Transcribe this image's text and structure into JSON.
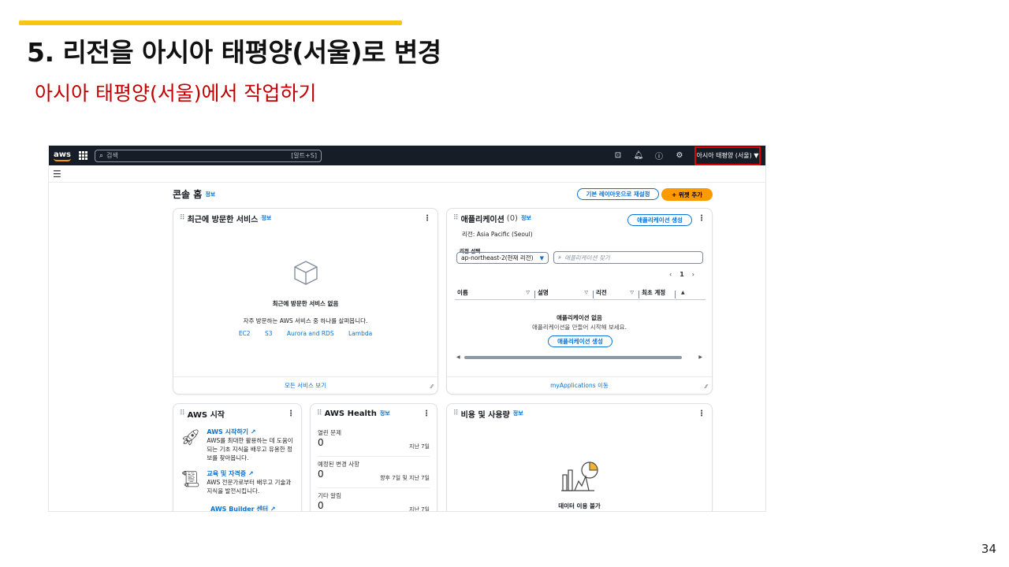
{
  "slide": {
    "title": "5. 리전을 아시아 태평양(서울)로 변경",
    "subtitle": "아시아 태평양(서울)에서 작업하기",
    "page_number": "34",
    "accent_color": "#f5c518",
    "subtitle_color": "#c00000"
  },
  "topnav": {
    "logo": "aws",
    "search_placeholder": "검색",
    "search_shortcut": "[알트+S]",
    "region_label": "아시아 태평양 (서울) ▼"
  },
  "console": {
    "title": "콘솔 홈",
    "info": "정보",
    "reset_button": "기본 레이아웃으로 재설정",
    "add_widget_button": "+ 위젯 추가"
  },
  "recent": {
    "title": "최근에 방문한 서비스",
    "info": "정보",
    "empty_title": "최근에 방문한 서비스 없음",
    "empty_desc": "자주 방문하는 AWS 서비스 중 하나를 살펴봅니다.",
    "links": [
      "EC2",
      "S3",
      "Aurora and RDS",
      "Lambda"
    ],
    "footer": "모든 서비스 보기"
  },
  "apps": {
    "title": "애플리케이션",
    "count": "(0)",
    "info": "정보",
    "create_button": "애플리케이션 생성",
    "region_text": "리전: Asia Pacific (Seoul)",
    "region_select_label": "리전 선택",
    "region_select_value": "ap-northeast-2(현재 리전)",
    "search_placeholder": "애플리케이션 찾기",
    "page": "1",
    "columns": [
      "이름",
      "설명",
      "리전",
      "최초 계정"
    ],
    "empty_title": "애플리케이션 없음",
    "empty_desc": "애플리케이션을 만들어 시작해 보세요.",
    "empty_button": "애플리케이션 생성",
    "footer": "myApplications 이동"
  },
  "start": {
    "title": "AWS 시작",
    "items": [
      {
        "title": "AWS 시작하기 ↗",
        "desc": "AWS를 최대한 활용하는 데 도움이 되는 기초 지식을 배우고 유용한 정보를 찾아봅니다."
      },
      {
        "title": "교육 및 자격증 ↗",
        "desc": "AWS 전문가로부터 배우고 기술과 지식을 발전시킵니다."
      },
      {
        "title": "AWS Builder 센터 ↗",
        "desc": ""
      }
    ]
  },
  "health": {
    "title": "AWS Health",
    "info": "정보",
    "rows": [
      {
        "label": "열린 문제",
        "value": "0",
        "period": "지난 7일"
      },
      {
        "label": "예정된 변경 사항",
        "value": "0",
        "period": "향후 7일 및 지난 7일"
      },
      {
        "label": "기타 알림",
        "value": "0",
        "period": "지난 7일"
      }
    ]
  },
  "cost": {
    "title": "비용 및 사용량",
    "info": "정보",
    "empty_title": "데이터 이용 불가"
  }
}
